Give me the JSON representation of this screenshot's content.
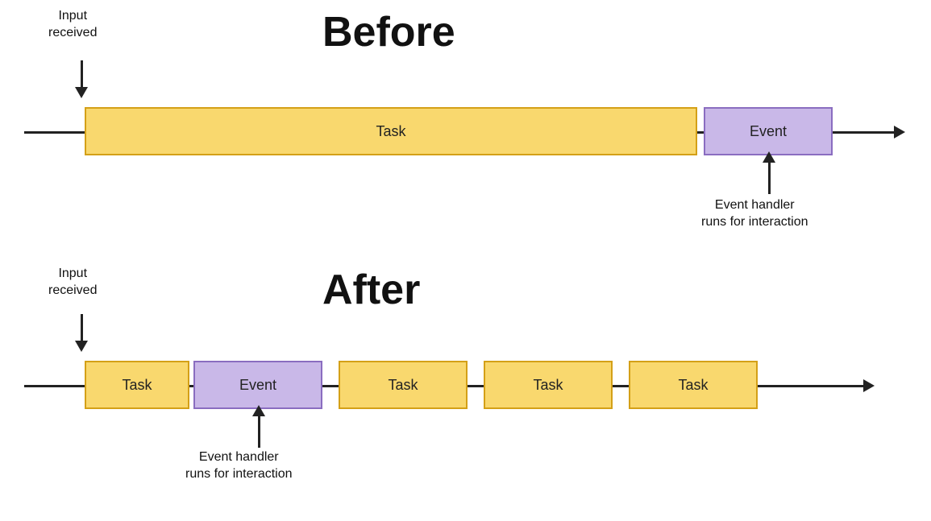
{
  "before": {
    "title": "Before",
    "input_label": "Input\nreceived",
    "event_handler_label": "Event handler\nruns for interaction",
    "task_label": "Task",
    "event_label": "Event"
  },
  "after": {
    "title": "After",
    "input_label": "Input\nreceived",
    "event_handler_label": "Event handler\nruns for interaction",
    "task_label": "Task",
    "event_label": "Event"
  }
}
